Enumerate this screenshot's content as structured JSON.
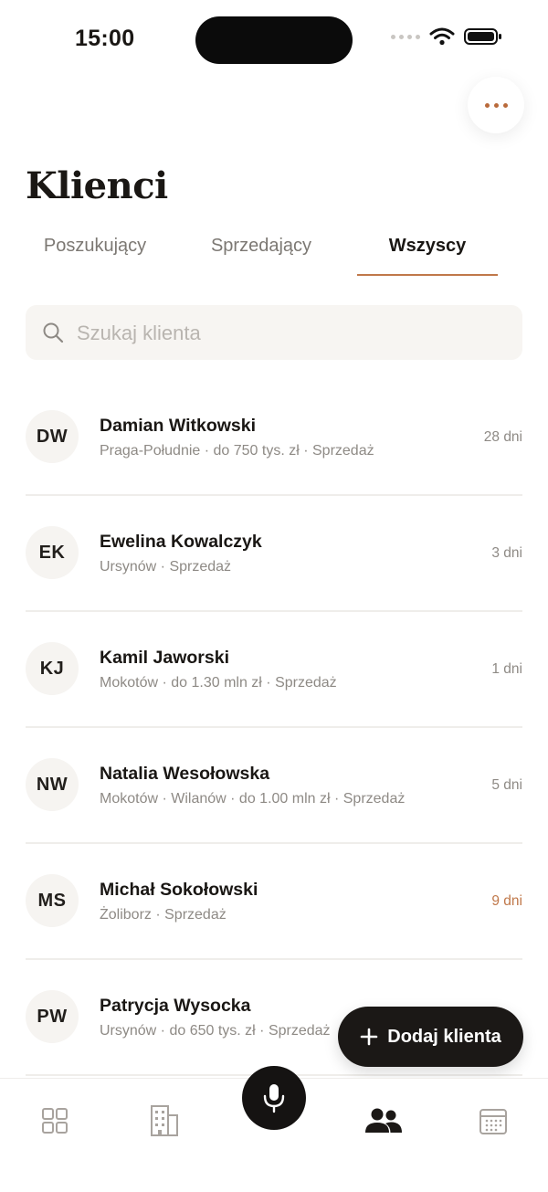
{
  "status_bar": {
    "time": "15:00"
  },
  "header": {
    "title": "Klienci",
    "more_icon": "more-horizontal-icon"
  },
  "tabs": [
    {
      "label": "Poszukujący",
      "active": false
    },
    {
      "label": "Sprzedający",
      "active": false
    },
    {
      "label": "Wszyscy",
      "active": true
    }
  ],
  "search": {
    "placeholder": "Szukaj klienta",
    "value": ""
  },
  "clients": [
    {
      "initials": "DW",
      "name": "Damian Witkowski",
      "meta": "Praga-Południe · do 750 tys. zł · Sprzedaż",
      "days": "28 dni",
      "highlight": false
    },
    {
      "initials": "EK",
      "name": "Ewelina Kowalczyk",
      "meta": "Ursynów · Sprzedaż",
      "days": "3 dni",
      "highlight": false
    },
    {
      "initials": "KJ",
      "name": "Kamil Jaworski",
      "meta": "Mokotów · do 1.30 mln zł · Sprzedaż",
      "days": "1 dni",
      "highlight": false
    },
    {
      "initials": "NW",
      "name": "Natalia Wesołowska",
      "meta": "Mokotów · Wilanów · do 1.00 mln zł · Sprzedaż",
      "days": "5 dni",
      "highlight": false
    },
    {
      "initials": "MS",
      "name": "Michał Sokołowski",
      "meta": "Żoliborz · Sprzedaż",
      "days": "9 dni",
      "highlight": true
    },
    {
      "initials": "PW",
      "name": "Patrycja Wysocka",
      "meta": "Ursynów · do 650 tys. zł · Sprzedaż",
      "days": "",
      "highlight": true
    }
  ],
  "add_button": {
    "label": "Dodaj klienta",
    "icon": "plus-icon"
  },
  "bottom_nav": [
    {
      "name": "dashboard",
      "icon": "grid-icon",
      "active": false
    },
    {
      "name": "properties",
      "icon": "building-icon",
      "active": false
    },
    {
      "name": "voice",
      "icon": "microphone-icon",
      "active": false
    },
    {
      "name": "clients",
      "icon": "users-icon",
      "active": true
    },
    {
      "name": "calendar",
      "icon": "calendar-icon",
      "active": false
    }
  ],
  "colors": {
    "accent": "#c0784a",
    "dark": "#1b1816",
    "muted": "#8e8a85",
    "background": "#ffffff"
  }
}
